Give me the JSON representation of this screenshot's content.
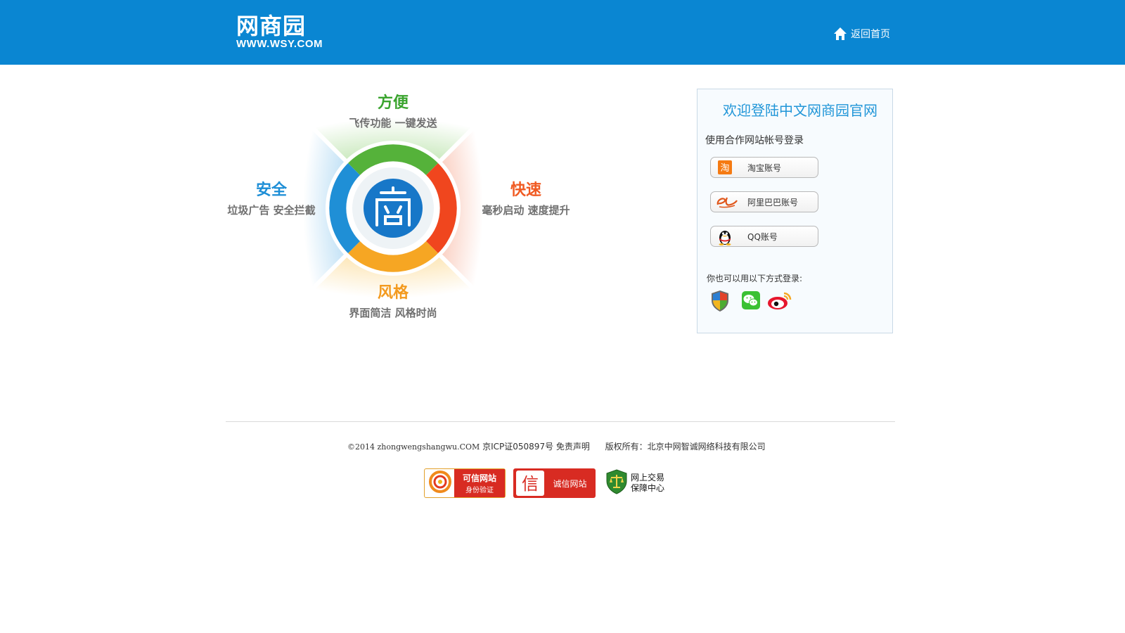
{
  "header": {
    "logo_cn": "网商园",
    "logo_en": "WWW.WSY.COM",
    "home_link": "返回首页",
    "home_icon": "home-icon",
    "bg_color": "#0a86d2"
  },
  "promo": {
    "top": {
      "title": "方便",
      "subtitle": "飞传功能 一键发送",
      "color": "#3aa42e"
    },
    "left": {
      "title": "安全",
      "subtitle": "垃圾广告 安全拦截",
      "color": "#1d8ed6"
    },
    "right": {
      "title": "快速",
      "subtitle": "毫秒启动 速度提升",
      "color": "#f05a22"
    },
    "bottom": {
      "title": "风格",
      "subtitle": "界面简洁 风格时尚",
      "color": "#f39a1e"
    },
    "center_icon": "shang-logo-icon"
  },
  "login": {
    "title": "欢迎登陆中文网商园官网",
    "partner_label": "使用合作网站帐号登录",
    "accounts": [
      {
        "label": "淘宝账号",
        "icon": "taobao-icon"
      },
      {
        "label": "阿里巴巴账号",
        "icon": "alibaba-icon"
      },
      {
        "label": "QQ账号",
        "icon": "qq-penguin-icon"
      }
    ],
    "also_label": "你也可以用以下方式登录:",
    "social": [
      {
        "icon": "shield-icon"
      },
      {
        "icon": "wechat-icon"
      },
      {
        "icon": "weibo-icon"
      }
    ]
  },
  "footer": {
    "copyright": "©2014 zhongwengshangwu.COM",
    "icp": "京ICP证050897号",
    "disclaimer": "免责声明",
    "owner": "版权所有：北京中网智诚网络科技有限公司",
    "badges": [
      {
        "line1": "可信网站",
        "line2": "身份验证"
      },
      {
        "line1": "诚信网站",
        "line2": ""
      },
      {
        "line1": "网上交易",
        "line2": "保障中心"
      }
    ]
  }
}
